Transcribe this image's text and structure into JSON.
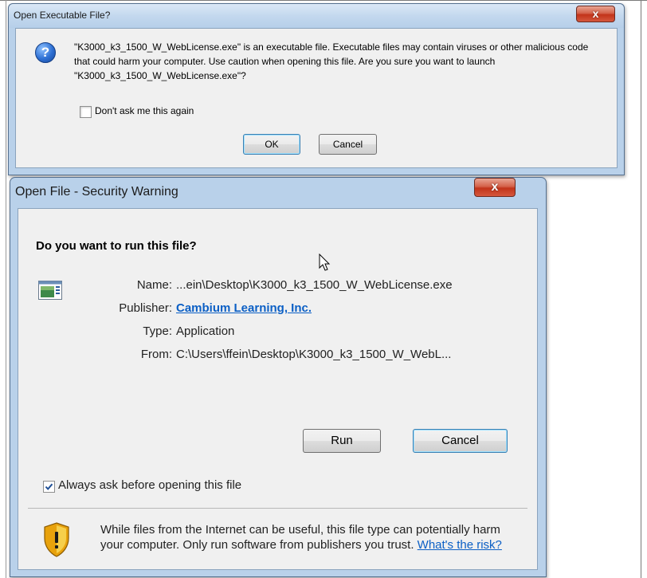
{
  "dialog1": {
    "title": "Open Executable File?",
    "close_label": "x",
    "message": "\"K3000_k3_1500_W_WebLicense.exe\" is an executable file. Executable files may contain viruses or other malicious code that could harm your computer. Use caution when opening this file. Are you sure you want to launch \"K3000_k3_1500_W_WebLicense.exe\"?",
    "dont_ask_label": "Don't ask me this again",
    "dont_ask_checked": false,
    "ok_label": "OK",
    "cancel_label": "Cancel",
    "icon": "question-icon"
  },
  "dialog2": {
    "title": "Open File - Security Warning",
    "close_label": "x",
    "heading": "Do you want to run this file?",
    "fields": {
      "name_label": "Name:",
      "name_value": "...ein\\Desktop\\K3000_k3_1500_W_WebLicense.exe",
      "publisher_label": "Publisher:",
      "publisher_value": "Cambium Learning, Inc.",
      "type_label": "Type:",
      "type_value": "Application",
      "from_label": "From:",
      "from_value": "C:\\Users\\ffein\\Desktop\\K3000_k3_1500_W_WebL..."
    },
    "run_label": "Run",
    "cancel_label": "Cancel",
    "always_ask_label": "Always ask before opening this file",
    "always_ask_checked": true,
    "info_text": "While files from the Internet can be useful, this file type can potentially harm your computer. Only run software from publishers you trust.",
    "risk_link": "What's the risk?",
    "icons": [
      "application-icon",
      "shield-warning-icon",
      "mouse-cursor-icon"
    ]
  },
  "colors": {
    "window_frame": "#b9d1ea",
    "close_red": "#c2341a",
    "link_blue": "#0b5fc5"
  }
}
